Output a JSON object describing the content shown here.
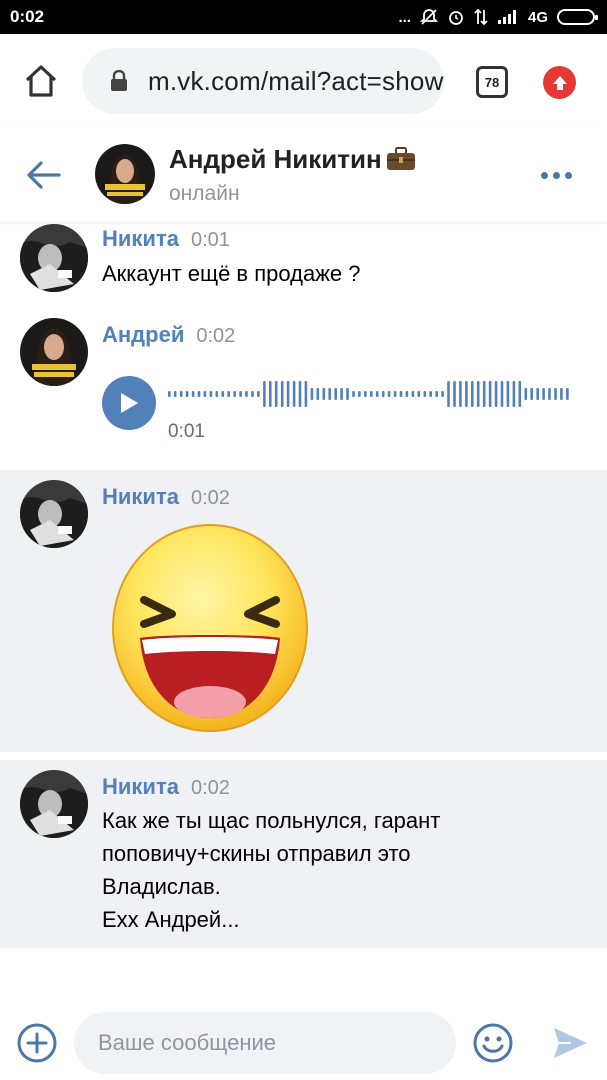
{
  "statusbar": {
    "time": "0:02",
    "dots": "...",
    "network": "4G"
  },
  "browser": {
    "url": "m.vk.com/mail?act=show",
    "tab_count": "78"
  },
  "chat": {
    "name": "Андрей Никитин",
    "status": "онлайн"
  },
  "messages": [
    {
      "author": "Никита",
      "time": "0:01",
      "text": "Аккаунт ещё в продаже ?"
    },
    {
      "author": "Андрей",
      "time": "0:02",
      "audio_duration": "0:01"
    },
    {
      "author": "Никита",
      "time": "0:02",
      "sticker": "laughing-emoji-sticker"
    },
    {
      "author": "Никита",
      "time": "0:02",
      "lines": [
        "Как же ты щас польнулся, гарант",
        "поповичу+скины отправил это",
        "Владислав.",
        "Ехх Андрей..."
      ]
    }
  ],
  "composer": {
    "placeholder": "Ваше сообщение"
  },
  "colors": {
    "accent": "#5181b8",
    "highlight_bg": "#f0f1f4",
    "update_red": "#e53935"
  }
}
